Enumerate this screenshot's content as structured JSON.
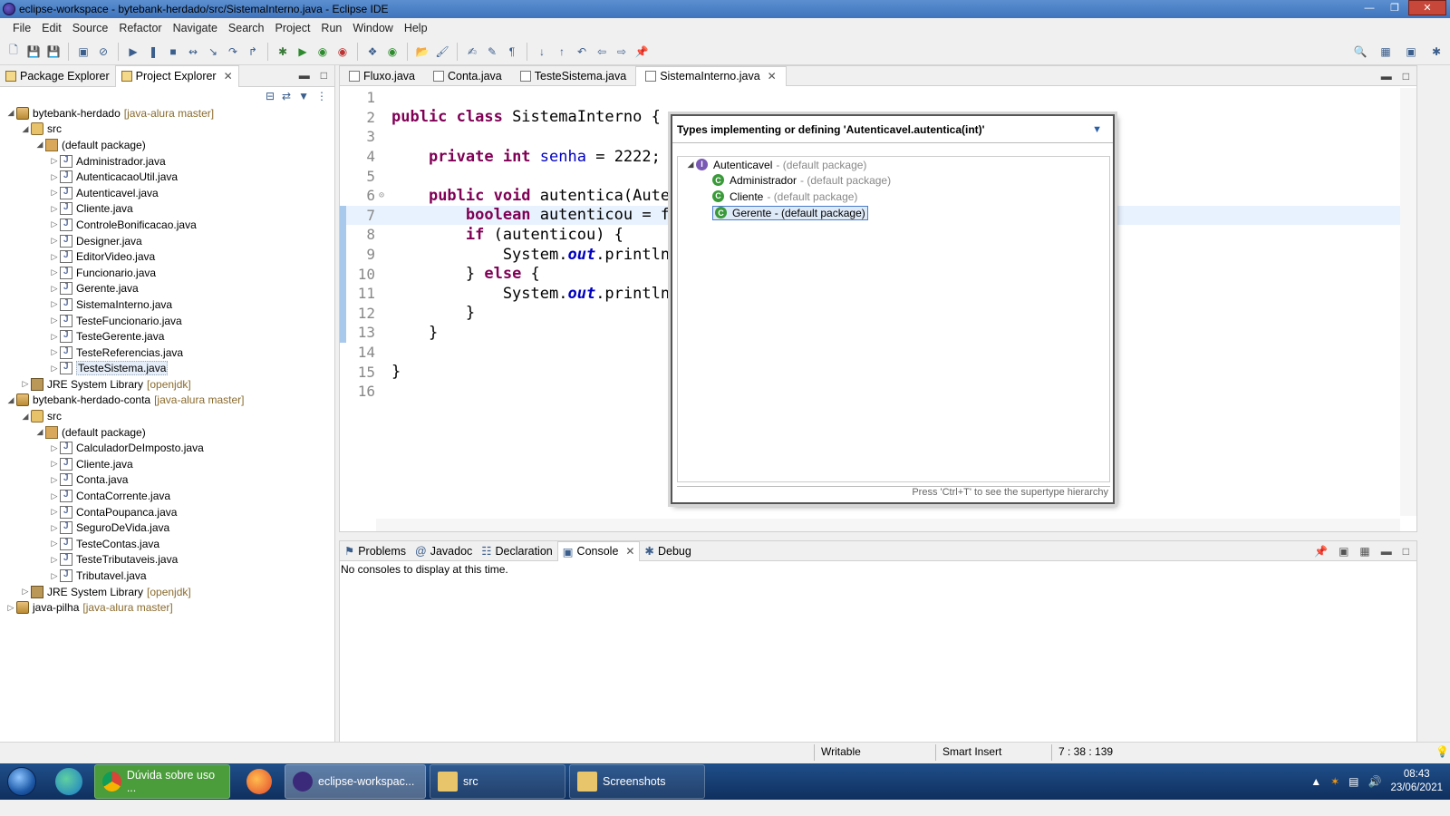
{
  "window": {
    "title": "eclipse-workspace - bytebank-herdado/src/SistemaInterno.java - Eclipse IDE"
  },
  "menu": [
    "File",
    "Edit",
    "Source",
    "Refactor",
    "Navigate",
    "Search",
    "Project",
    "Run",
    "Window",
    "Help"
  ],
  "left_panel": {
    "tabs": [
      {
        "label": "Package Explorer"
      },
      {
        "label": "Project Explorer"
      }
    ],
    "tree": [
      {
        "level": 0,
        "expanded": true,
        "type": "project",
        "label": "bytebank-herdado",
        "git": "[java-alura master]"
      },
      {
        "level": 1,
        "expanded": true,
        "type": "folder",
        "label": "src",
        "git": ""
      },
      {
        "level": 2,
        "expanded": true,
        "type": "package",
        "label": "(default package)",
        "git": ""
      },
      {
        "level": 3,
        "expanded": false,
        "type": "java",
        "label": "Administrador.java",
        "git": ""
      },
      {
        "level": 3,
        "expanded": false,
        "type": "java",
        "label": "AutenticacaoUtil.java",
        "git": ""
      },
      {
        "level": 3,
        "expanded": false,
        "type": "java",
        "label": "Autenticavel.java",
        "git": ""
      },
      {
        "level": 3,
        "expanded": false,
        "type": "java",
        "label": "Cliente.java",
        "git": ""
      },
      {
        "level": 3,
        "expanded": false,
        "type": "java",
        "label": "ControleBonificacao.java",
        "git": ""
      },
      {
        "level": 3,
        "expanded": false,
        "type": "java",
        "label": "Designer.java",
        "git": ""
      },
      {
        "level": 3,
        "expanded": false,
        "type": "java",
        "label": "EditorVideo.java",
        "git": ""
      },
      {
        "level": 3,
        "expanded": false,
        "type": "java",
        "label": "Funcionario.java",
        "git": ""
      },
      {
        "level": 3,
        "expanded": false,
        "type": "java",
        "label": "Gerente.java",
        "git": ""
      },
      {
        "level": 3,
        "expanded": false,
        "type": "java",
        "label": "SistemaInterno.java",
        "git": ""
      },
      {
        "level": 3,
        "expanded": false,
        "type": "java",
        "label": "TesteFuncionario.java",
        "git": ""
      },
      {
        "level": 3,
        "expanded": false,
        "type": "java",
        "label": "TesteGerente.java",
        "git": ""
      },
      {
        "level": 3,
        "expanded": false,
        "type": "java",
        "label": "TesteReferencias.java",
        "git": ""
      },
      {
        "level": 3,
        "expanded": false,
        "type": "java",
        "label": "TesteSistema.java",
        "git": "",
        "selected": true
      },
      {
        "level": 1,
        "expanded": false,
        "type": "lib",
        "label": "JRE System Library",
        "git": "[openjdk]"
      },
      {
        "level": 0,
        "expanded": true,
        "type": "project",
        "label": "bytebank-herdado-conta",
        "git": "[java-alura master]"
      },
      {
        "level": 1,
        "expanded": true,
        "type": "folder",
        "label": "src",
        "git": ""
      },
      {
        "level": 2,
        "expanded": true,
        "type": "package",
        "label": "(default package)",
        "git": ""
      },
      {
        "level": 3,
        "expanded": false,
        "type": "java",
        "label": "CalculadorDeImposto.java",
        "git": ""
      },
      {
        "level": 3,
        "expanded": false,
        "type": "java",
        "label": "Cliente.java",
        "git": ""
      },
      {
        "level": 3,
        "expanded": false,
        "type": "java",
        "label": "Conta.java",
        "git": ""
      },
      {
        "level": 3,
        "expanded": false,
        "type": "java",
        "label": "ContaCorrente.java",
        "git": ""
      },
      {
        "level": 3,
        "expanded": false,
        "type": "java",
        "label": "ContaPoupanca.java",
        "git": ""
      },
      {
        "level": 3,
        "expanded": false,
        "type": "java",
        "label": "SeguroDeVida.java",
        "git": ""
      },
      {
        "level": 3,
        "expanded": false,
        "type": "java",
        "label": "TesteContas.java",
        "git": ""
      },
      {
        "level": 3,
        "expanded": false,
        "type": "java",
        "label": "TesteTributaveis.java",
        "git": ""
      },
      {
        "level": 3,
        "expanded": false,
        "type": "java",
        "label": "Tributavel.java",
        "git": ""
      },
      {
        "level": 1,
        "expanded": false,
        "type": "lib",
        "label": "JRE System Library",
        "git": "[openjdk]"
      },
      {
        "level": 0,
        "expanded": false,
        "type": "project",
        "label": "java-pilha",
        "git": "[java-alura master]"
      }
    ]
  },
  "editor": {
    "tabs": [
      {
        "label": "Fluxo.java",
        "active": false
      },
      {
        "label": "Conta.java",
        "active": false
      },
      {
        "label": "TesteSistema.java",
        "active": false
      },
      {
        "label": "SistemaInterno.java",
        "active": true
      }
    ],
    "lines": [
      {
        "n": "1",
        "html": ""
      },
      {
        "n": "2",
        "html": "<span class=\"kw\">public class</span> SistemaInterno {"
      },
      {
        "n": "3",
        "html": ""
      },
      {
        "n": "4",
        "html": "    <span class=\"kw\">private int</span> <span class=\"fld\">senha</span> = 2222;"
      },
      {
        "n": "5",
        "html": ""
      },
      {
        "n": "6",
        "html": "    <span class=\"kw\">public void</span> autentica(Autenti",
        "fold": true
      },
      {
        "n": "7",
        "html": "        <span class=\"kw\">boolean</span> autenticou = fa.a",
        "current": true,
        "marked": true
      },
      {
        "n": "8",
        "html": "        <span class=\"kw\">if</span> (autenticou) {",
        "marked": true
      },
      {
        "n": "9",
        "html": "            System.<span class=\"st\">out</span>.println(<span class=\"str\">\"P</span>",
        "marked": true
      },
      {
        "n": "10",
        "html": "        } <span class=\"kw\">else</span> {",
        "marked": true
      },
      {
        "n": "11",
        "html": "            System.<span class=\"st\">out</span>.println(<span class=\"str\">\"N</span>",
        "marked": true
      },
      {
        "n": "12",
        "html": "        }",
        "marked": true
      },
      {
        "n": "13",
        "html": "    }",
        "marked": true
      },
      {
        "n": "14",
        "html": ""
      },
      {
        "n": "15",
        "html": "}"
      },
      {
        "n": "16",
        "html": ""
      }
    ]
  },
  "popup": {
    "header": "Types implementing or defining 'Autenticavel.autentica(int)'",
    "rows": [
      {
        "name": "Autenticavel",
        "pkg": "- (default package)",
        "kind": "interface",
        "expanded": true
      },
      {
        "name": "Administrador",
        "pkg": "- (default package)",
        "kind": "class"
      },
      {
        "name": "Cliente",
        "pkg": "- (default package)",
        "kind": "class"
      },
      {
        "name": "Gerente - (default package)",
        "pkg": "",
        "kind": "class",
        "selected": true
      }
    ],
    "footer": "Press 'Ctrl+T' to see the supertype hierarchy"
  },
  "bottom_panel": {
    "tabs": [
      {
        "label": "Problems",
        "active": false
      },
      {
        "label": "Javadoc",
        "active": false
      },
      {
        "label": "Declaration",
        "active": false
      },
      {
        "label": "Console",
        "active": true
      },
      {
        "label": "Debug",
        "active": false
      }
    ],
    "message": "No consoles to display at this time."
  },
  "status": {
    "mode": "Writable",
    "insert": "Smart Insert",
    "position": "7 : 38 : 139"
  },
  "taskbar": {
    "buttons": [
      {
        "label": "Dúvida sobre uso ...",
        "style": "chrome"
      },
      {
        "label": "eclipse-workspac...",
        "style": "active"
      },
      {
        "label": "src",
        "style": ""
      },
      {
        "label": "Screenshots",
        "style": ""
      }
    ],
    "time": "08:43",
    "date": "23/06/2021"
  },
  "colors": {
    "titlebar": "#4a80c7",
    "keyword": "#7f0055",
    "field": "#0000c0",
    "string": "#2a00ff",
    "current_line": "#e8f2fe"
  }
}
